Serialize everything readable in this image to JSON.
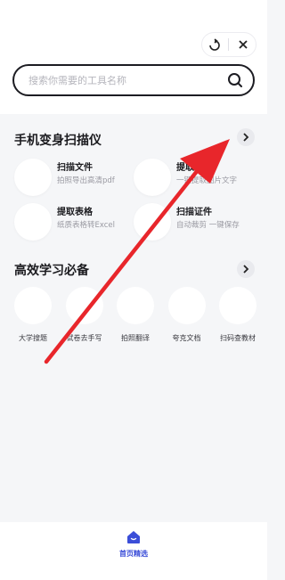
{
  "capsule": {
    "more_icon": "more-dots-icon",
    "close_icon": "close-icon"
  },
  "search": {
    "placeholder": "搜索你需要的工具名称",
    "value": ""
  },
  "section_scan": {
    "title": "手机变身扫描仪",
    "tools": [
      {
        "name": "扫描文件",
        "desc": "拍照导出高清pdf"
      },
      {
        "name": "提取",
        "desc": "一键提取图片文字"
      },
      {
        "name": "提取表格",
        "desc": "纸质表格转Excel"
      },
      {
        "name": "扫描证件",
        "desc": "自动裁剪 一键保存"
      }
    ]
  },
  "section_study": {
    "title": "高效学习必备",
    "items": [
      {
        "label": "大学搜题"
      },
      {
        "label": "试卷去手写"
      },
      {
        "label": "拍照翻译"
      },
      {
        "label": "夸克文档"
      },
      {
        "label": "扫码查教材"
      }
    ]
  },
  "tabbar": {
    "home_label": "首页精选"
  },
  "colors": {
    "accent": "#3b4ed8",
    "arrow": "#e8262b"
  }
}
